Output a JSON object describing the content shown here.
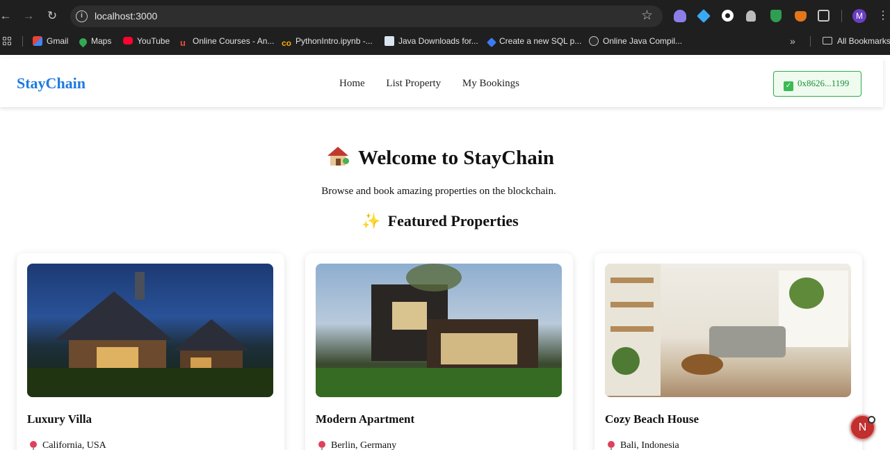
{
  "browser": {
    "url": "localhost:3000",
    "profile_initial": "M",
    "bookmarks": [
      {
        "label": "Gmail",
        "icon": "gmail-icon"
      },
      {
        "label": "Maps",
        "icon": "maps-icon"
      },
      {
        "label": "YouTube",
        "icon": "youtube-icon"
      },
      {
        "label": "Online Courses - An...",
        "icon": "courses-icon"
      },
      {
        "label": "PythonIntro.ipynb -...",
        "icon": "colab-icon"
      },
      {
        "label": "Java Downloads for...",
        "icon": "java-icon"
      },
      {
        "label": "Create a new SQL p...",
        "icon": "sql-icon"
      },
      {
        "label": "Online Java Compil...",
        "icon": "compiler-icon"
      }
    ],
    "more_label": "»",
    "all_bookmarks": "All Bookmarks"
  },
  "navbar": {
    "brand": "StayChain",
    "links": [
      "Home",
      "List Property",
      "My Bookings"
    ],
    "wallet": "0x8626...1199",
    "wallet_color": "#2eaa4a"
  },
  "hero": {
    "title": "Welcome to StayChain",
    "subtitle": "Browse and book amazing properties on the blockchain.",
    "featured": "Featured Properties"
  },
  "properties": [
    {
      "title": "Luxury Villa",
      "location": "California, USA"
    },
    {
      "title": "Modern Apartment",
      "location": "Berlin, Germany"
    },
    {
      "title": "Cozy Beach House",
      "location": "Bali, Indonesia"
    }
  ],
  "dev_badge": "N",
  "colors": {
    "brand": "#1f7ae0",
    "wallet_bg": "#eefbee"
  }
}
